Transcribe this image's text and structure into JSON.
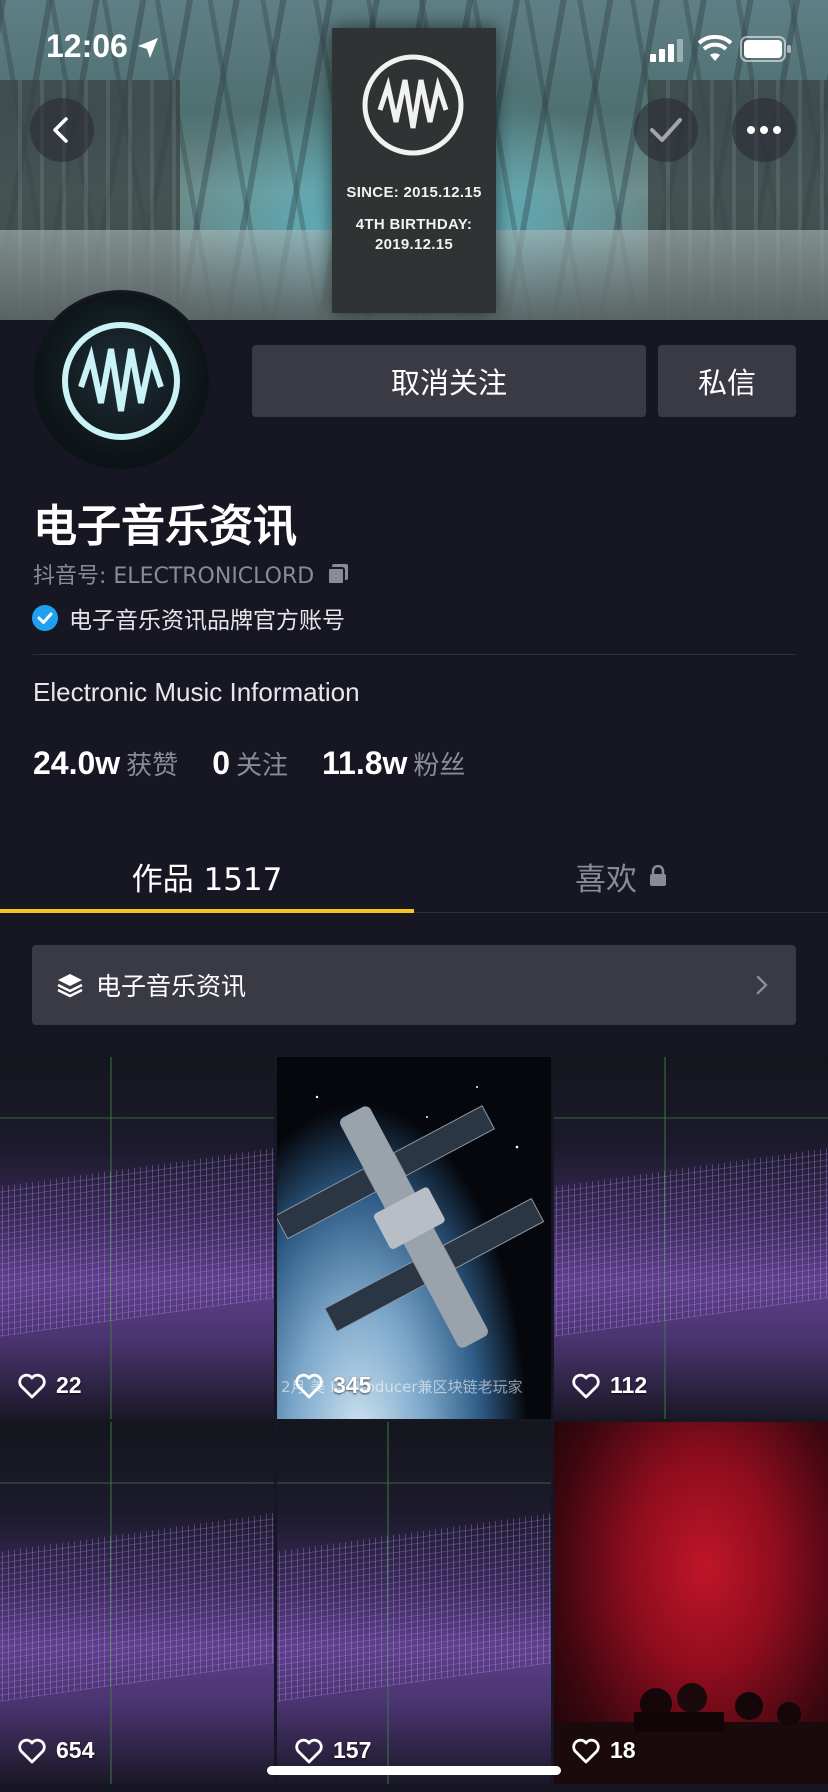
{
  "status_bar": {
    "time": "12:06"
  },
  "banner": {
    "poster_since": "SINCE: 2015.12.15",
    "poster_birthday_line1": "4TH BIRTHDAY:",
    "poster_birthday_line2": "2019.12.15"
  },
  "icons": {
    "back": "chevron-left-icon",
    "check": "check-icon",
    "more": "more-dots-icon",
    "copy": "copy-icon",
    "verified": "verified-badge-icon",
    "lock": "lock-icon",
    "collection": "layers-icon",
    "chevron": "chevron-right-icon",
    "like": "heart-icon"
  },
  "actions": {
    "unfollow_label": "取消关注",
    "message_label": "私信"
  },
  "profile": {
    "name": "电子音乐资讯",
    "douyin_id": "抖音号: ELECTRONICLORD",
    "verified_text": "电子音乐资讯品牌官方账号",
    "bio": "Electronic Music Information"
  },
  "stats": [
    {
      "value": "24.0w",
      "label": "获赞"
    },
    {
      "value": "0",
      "label": "关注"
    },
    {
      "value": "11.8w",
      "label": "粉丝"
    }
  ],
  "tabs": {
    "works": "作品 1517",
    "likes": "喜欢"
  },
  "collection": {
    "label": "电子音乐资讯"
  },
  "videos": [
    {
      "likes": "22",
      "style": "purple"
    },
    {
      "likes": "345",
      "style": "space",
      "caption": "2月 美 DJ/Producer兼区块链老玩家"
    },
    {
      "likes": "112",
      "style": "purple"
    },
    {
      "likes": "654",
      "style": "purple"
    },
    {
      "likes": "157",
      "style": "purple"
    },
    {
      "likes": "18",
      "style": "red"
    }
  ],
  "colors": {
    "background": "#161723",
    "button": "#393a44",
    "accent_underline": "#f6c51e",
    "verified_blue": "#20a0f0",
    "muted_text": "#8a8b93"
  }
}
